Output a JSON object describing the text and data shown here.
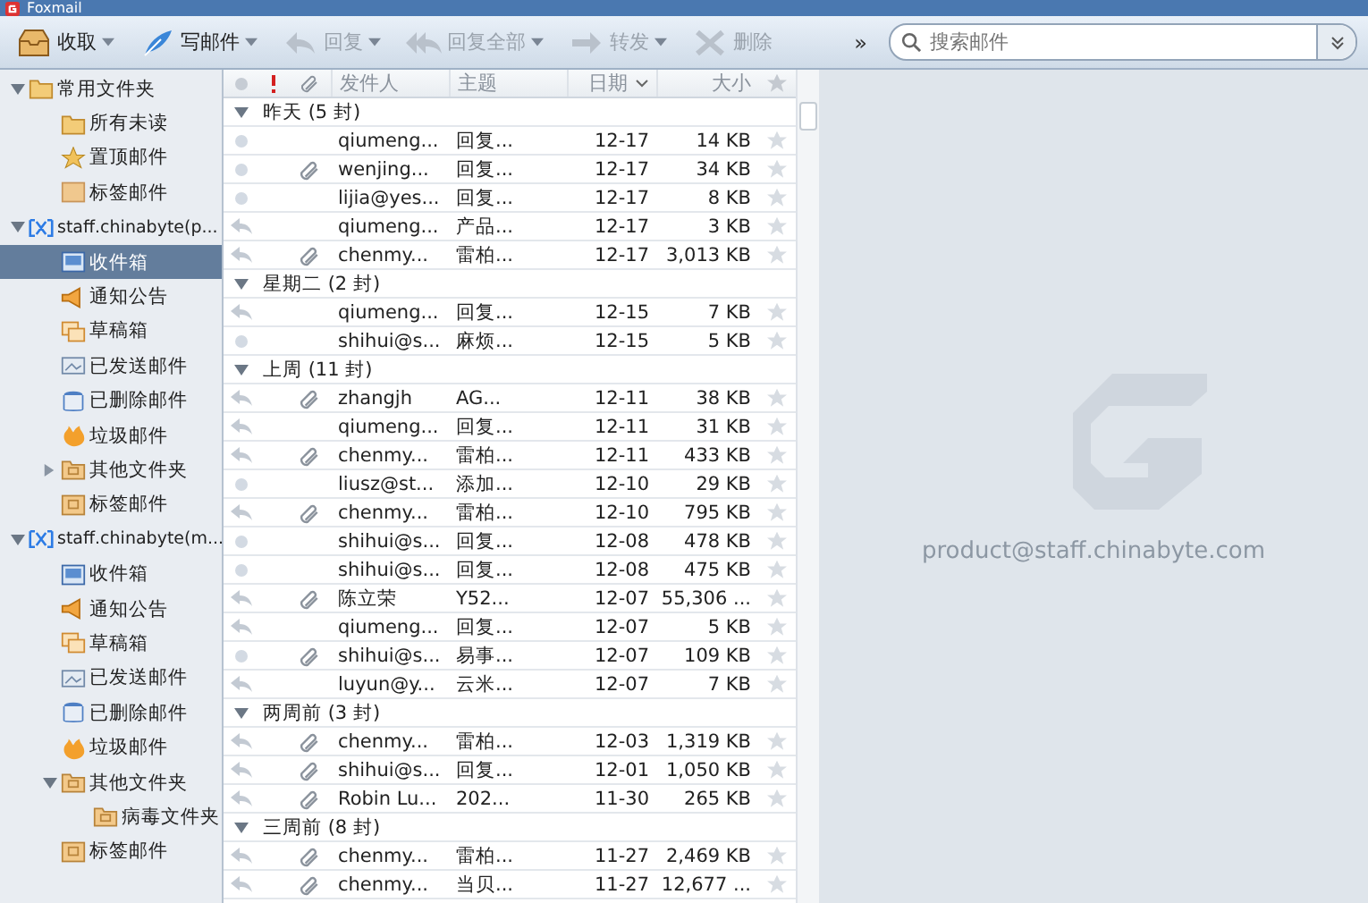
{
  "window": {
    "title": "Foxmail"
  },
  "toolbar": {
    "buttons": [
      {
        "label": "收取",
        "kind": "receive",
        "dropdown": true,
        "disabled": false
      },
      {
        "label": "写邮件",
        "kind": "compose",
        "dropdown": true,
        "disabled": false
      },
      {
        "label": "回复",
        "kind": "reply",
        "dropdown": true,
        "disabled": true
      },
      {
        "label": "回复全部",
        "kind": "replyall",
        "dropdown": true,
        "disabled": true
      },
      {
        "label": "转发",
        "kind": "forward",
        "dropdown": true,
        "disabled": true
      },
      {
        "label": "删除",
        "kind": "delete",
        "dropdown": false,
        "disabled": true
      }
    ],
    "overflow": "»",
    "search": {
      "placeholder": "搜索邮件"
    }
  },
  "sidebar": {
    "items": [
      {
        "label": "常用文件夹",
        "kind": "folder",
        "expanded": true,
        "selected": false,
        "children": [
          {
            "label": "所有未读",
            "kind": "folder",
            "selected": false
          },
          {
            "label": "置顶邮件",
            "kind": "star",
            "selected": false
          },
          {
            "label": "标签邮件",
            "kind": "tag",
            "selected": false
          }
        ]
      },
      {
        "label": "staff.chinabyte(p...",
        "kind": "account",
        "expanded": true,
        "selected": false,
        "children": [
          {
            "label": "收件箱",
            "kind": "inbox",
            "selected": true
          },
          {
            "label": "通知公告",
            "kind": "notice",
            "selected": false
          },
          {
            "label": "草稿箱",
            "kind": "drafts",
            "selected": false
          },
          {
            "label": "已发送邮件",
            "kind": "sent",
            "selected": false
          },
          {
            "label": "已删除邮件",
            "kind": "trash",
            "selected": false
          },
          {
            "label": "垃圾邮件",
            "kind": "spam",
            "selected": false
          },
          {
            "label": "其他文件夹",
            "kind": "subfolder",
            "expanded": false,
            "selected": false
          },
          {
            "label": "标签邮件",
            "kind": "tagbox",
            "selected": false
          }
        ]
      },
      {
        "label": "staff.chinabyte(m...",
        "kind": "account",
        "expanded": true,
        "selected": false,
        "children": [
          {
            "label": "收件箱",
            "kind": "inbox",
            "selected": false
          },
          {
            "label": "通知公告",
            "kind": "notice",
            "selected": false
          },
          {
            "label": "草稿箱",
            "kind": "drafts",
            "selected": false
          },
          {
            "label": "已发送邮件",
            "kind": "sent",
            "selected": false
          },
          {
            "label": "已删除邮件",
            "kind": "trash",
            "selected": false
          },
          {
            "label": "垃圾邮件",
            "kind": "spam",
            "selected": false
          },
          {
            "label": "其他文件夹",
            "kind": "subfolder",
            "expanded": true,
            "selected": false,
            "children": [
              {
                "label": "病毒文件夹",
                "kind": "subfolder",
                "selected": false
              }
            ]
          },
          {
            "label": "标签邮件",
            "kind": "tagbox",
            "selected": false
          }
        ]
      }
    ]
  },
  "message_list": {
    "columns": {
      "sender": "发件人",
      "subject": "主题",
      "date": "日期",
      "size": "大小"
    },
    "groups": [
      {
        "label": "昨天 (5 封)",
        "expanded": true,
        "rows": [
          {
            "replied": false,
            "attachment": false,
            "sender": "qiumeng...",
            "subject": "回复...",
            "date": "12-17",
            "size": "14 KB",
            "starred": false
          },
          {
            "replied": false,
            "attachment": true,
            "sender": "wenjing...",
            "subject": "回复...",
            "date": "12-17",
            "size": "34 KB",
            "starred": false
          },
          {
            "replied": false,
            "attachment": false,
            "sender": "lijia@yes...",
            "subject": "回复...",
            "date": "12-17",
            "size": "8 KB",
            "starred": false
          },
          {
            "replied": true,
            "attachment": false,
            "sender": "qiumeng...",
            "subject": "产品...",
            "date": "12-17",
            "size": "3 KB",
            "starred": false
          },
          {
            "replied": true,
            "attachment": true,
            "sender": "chenmy...",
            "subject": "雷柏...",
            "date": "12-17",
            "size": "3,013 KB",
            "starred": false
          }
        ]
      },
      {
        "label": "星期二 (2 封)",
        "expanded": true,
        "rows": [
          {
            "replied": true,
            "attachment": false,
            "sender": "qiumeng...",
            "subject": "回复...",
            "date": "12-15",
            "size": "7 KB",
            "starred": false
          },
          {
            "replied": false,
            "attachment": false,
            "sender": "shihui@s...",
            "subject": "麻烦...",
            "date": "12-15",
            "size": "5 KB",
            "starred": false
          }
        ]
      },
      {
        "label": "上周 (11 封)",
        "expanded": true,
        "rows": [
          {
            "replied": true,
            "attachment": true,
            "sender": "zhangjh",
            "subject": "AG...",
            "date": "12-11",
            "size": "38 KB",
            "starred": false
          },
          {
            "replied": true,
            "attachment": false,
            "sender": "qiumeng...",
            "subject": "回复...",
            "date": "12-11",
            "size": "31 KB",
            "starred": false
          },
          {
            "replied": true,
            "attachment": true,
            "sender": "chenmy...",
            "subject": "雷柏...",
            "date": "12-11",
            "size": "433 KB",
            "starred": false
          },
          {
            "replied": false,
            "attachment": false,
            "sender": "liusz@st...",
            "subject": "添加...",
            "date": "12-10",
            "size": "29 KB",
            "starred": false
          },
          {
            "replied": true,
            "attachment": true,
            "sender": "chenmy...",
            "subject": "雷柏...",
            "date": "12-10",
            "size": "795 KB",
            "starred": false
          },
          {
            "replied": false,
            "attachment": false,
            "sender": "shihui@s...",
            "subject": "回复...",
            "date": "12-08",
            "size": "478 KB",
            "starred": false
          },
          {
            "replied": false,
            "attachment": false,
            "sender": "shihui@s...",
            "subject": "回复...",
            "date": "12-08",
            "size": "475 KB",
            "starred": false
          },
          {
            "replied": true,
            "attachment": true,
            "sender": "陈立荣",
            "subject": "Y52...",
            "date": "12-07",
            "size": "55,306 ...",
            "starred": false
          },
          {
            "replied": true,
            "attachment": false,
            "sender": "qiumeng...",
            "subject": "回复...",
            "date": "12-07",
            "size": "5 KB",
            "starred": false
          },
          {
            "replied": false,
            "attachment": true,
            "sender": "shihui@s...",
            "subject": "易事...",
            "date": "12-07",
            "size": "109 KB",
            "starred": false
          },
          {
            "replied": true,
            "attachment": false,
            "sender": "luyun@y...",
            "subject": "云米...",
            "date": "12-07",
            "size": "7 KB",
            "starred": false
          }
        ]
      },
      {
        "label": "两周前 (3 封)",
        "expanded": true,
        "rows": [
          {
            "replied": true,
            "attachment": true,
            "sender": "chenmy...",
            "subject": "雷柏...",
            "date": "12-03",
            "size": "1,319 KB",
            "starred": false
          },
          {
            "replied": true,
            "attachment": true,
            "sender": "shihui@s...",
            "subject": "回复...",
            "date": "12-01",
            "size": "1,050 KB",
            "starred": false
          },
          {
            "replied": true,
            "attachment": true,
            "sender": "Robin Lu...",
            "subject": "202...",
            "date": "11-30",
            "size": "265 KB",
            "starred": false
          }
        ]
      },
      {
        "label": "三周前 (8 封)",
        "expanded": true,
        "rows": [
          {
            "replied": true,
            "attachment": true,
            "sender": "chenmy...",
            "subject": "雷柏...",
            "date": "11-27",
            "size": "2,469 KB",
            "starred": false
          },
          {
            "replied": true,
            "attachment": true,
            "sender": "chenmy...",
            "subject": "当贝...",
            "date": "11-27",
            "size": "12,677 ...",
            "starred": false
          }
        ]
      }
    ]
  },
  "preview": {
    "account": "product@staff.chinabyte.com"
  }
}
